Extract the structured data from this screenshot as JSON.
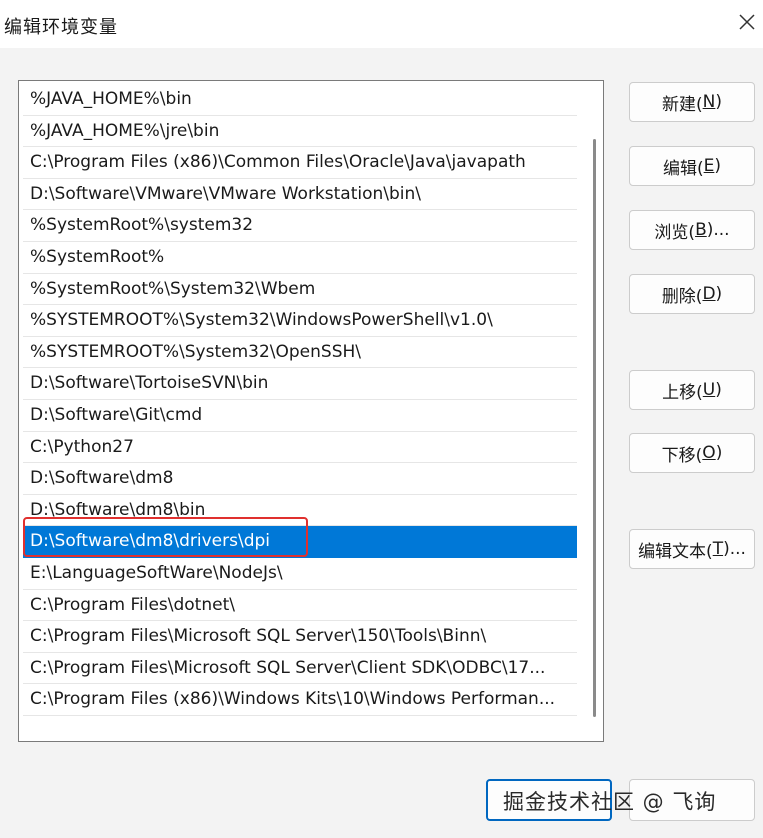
{
  "dialog": {
    "title": "编辑环境变量",
    "close_icon": "close-icon"
  },
  "path_list": {
    "items": [
      "%JAVA_HOME%\\bin",
      "%JAVA_HOME%\\jre\\bin",
      "C:\\Program Files (x86)\\Common Files\\Oracle\\Java\\javapath",
      "D:\\Software\\VMware\\VMware Workstation\\bin\\",
      "%SystemRoot%\\system32",
      "%SystemRoot%",
      "%SystemRoot%\\System32\\Wbem",
      "%SYSTEMROOT%\\System32\\WindowsPowerShell\\v1.0\\",
      "%SYSTEMROOT%\\System32\\OpenSSH\\",
      "D:\\Software\\TortoiseSVN\\bin",
      "D:\\Software\\Git\\cmd",
      "C:\\Python27",
      "D:\\Software\\dm8",
      "D:\\Software\\dm8\\bin",
      "D:\\Software\\dm8\\drivers\\dpi",
      "E:\\LanguageSoftWare\\NodeJs\\",
      "C:\\Program Files\\dotnet\\",
      "C:\\Program Files\\Microsoft SQL Server\\150\\Tools\\Binn\\",
      "C:\\Program Files\\Microsoft SQL Server\\Client SDK\\ODBC\\17...",
      "C:\\Program Files (x86)\\Windows Kits\\10\\Windows Performan..."
    ],
    "selected_index": 14,
    "selection_color": "#0078d7",
    "highlight_color": "#e0302e"
  },
  "buttons": {
    "new": {
      "label": "新建(",
      "accel": "N",
      "end": ")"
    },
    "edit": {
      "label": "编辑(",
      "accel": "E",
      "end": ")"
    },
    "browse": {
      "label": "浏览(",
      "accel": "B",
      "end": ")..."
    },
    "delete": {
      "label": "删除(",
      "accel": "D",
      "end": ")"
    },
    "move_up": {
      "label": "上移(",
      "accel": "U",
      "end": ")"
    },
    "move_down": {
      "label": "下移(",
      "accel": "O",
      "end": ")"
    },
    "edit_text": {
      "label": "编辑文本(",
      "accel": "T",
      "end": ")..."
    }
  },
  "footer": {
    "watermark": "掘金技术社区 @ 飞询"
  }
}
